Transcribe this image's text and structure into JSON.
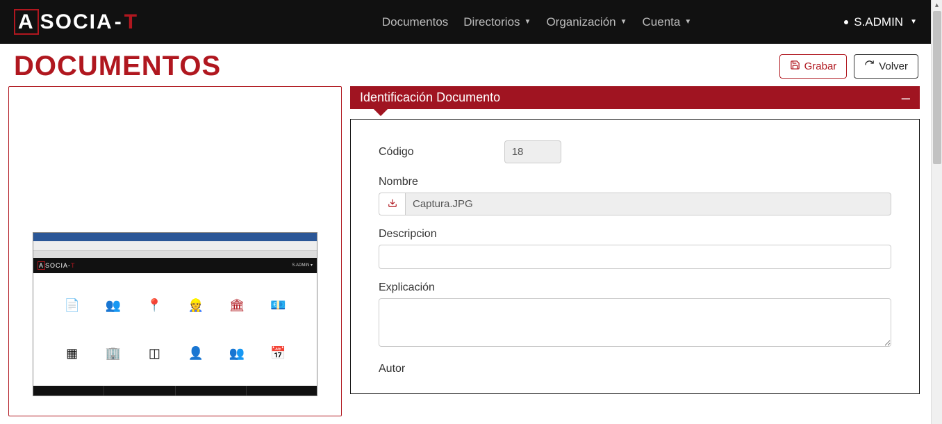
{
  "brand": {
    "a": "A",
    "socia": "SOCIA",
    "dash": "-",
    "t": "T"
  },
  "nav": {
    "documentos": "Documentos",
    "directorios": "Directorios",
    "organizacion": "Organización",
    "cuenta": "Cuenta",
    "user": "S.ADMIN"
  },
  "page": {
    "title": "DOCUMENTOS"
  },
  "buttons": {
    "grabar": "Grabar",
    "volver": "Volver"
  },
  "panel": {
    "title": "Identificación Documento"
  },
  "form": {
    "codigo_label": "Código",
    "codigo_value": "18",
    "nombre_label": "Nombre",
    "nombre_value": "Captura.JPG",
    "descripcion_label": "Descripcion",
    "descripcion_value": "",
    "explicacion_label": "Explicación",
    "explicacion_value": "",
    "autor_label": "Autor"
  },
  "thumb": {
    "brand_a": "A",
    "brand_socia": "SOCIA",
    "brand_dash": "-",
    "brand_t": "T",
    "user": "S.ADMIN ▾"
  }
}
